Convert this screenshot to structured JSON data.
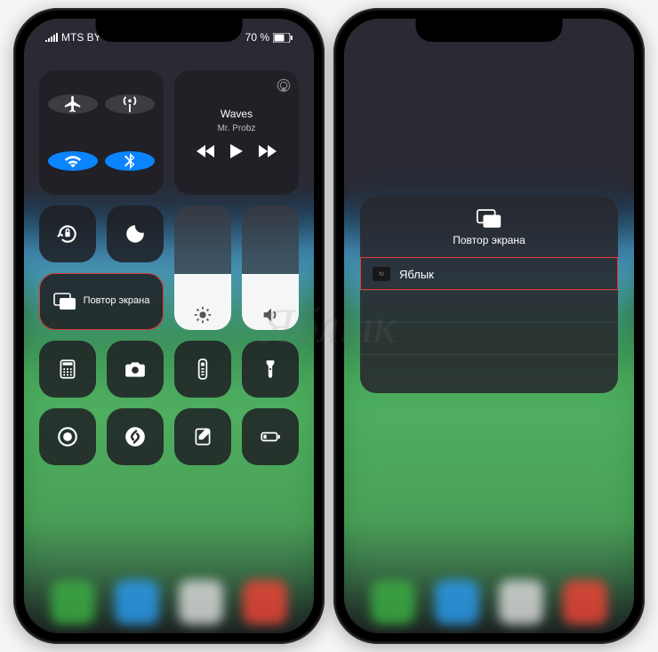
{
  "watermark": "Яблык",
  "left": {
    "status": {
      "carrier": "MTS BY",
      "battery": "70 %"
    },
    "media": {
      "title": "Waves",
      "artist": "Mr. Probz"
    },
    "mirror_label": "Повтор экрана"
  },
  "right": {
    "picker": {
      "title": "Повтор экрана",
      "device": "Яблык"
    }
  },
  "icons": {
    "airplane": "airplane-icon",
    "antenna": "cellular-data-icon",
    "wifi": "wifi-icon",
    "bluetooth": "bluetooth-icon",
    "lock": "orientation-lock-icon",
    "moon": "do-not-disturb-icon",
    "mirror": "screen-mirroring-icon",
    "airplay": "airplay-icon",
    "brightness": "brightness-icon",
    "volume": "volume-icon",
    "calculator": "calculator-icon",
    "camera": "camera-icon",
    "remote": "remote-icon",
    "flashlight": "flashlight-icon",
    "record": "screen-record-icon",
    "shazam": "shazam-icon",
    "notes": "notes-icon",
    "lowpower": "low-power-icon"
  }
}
